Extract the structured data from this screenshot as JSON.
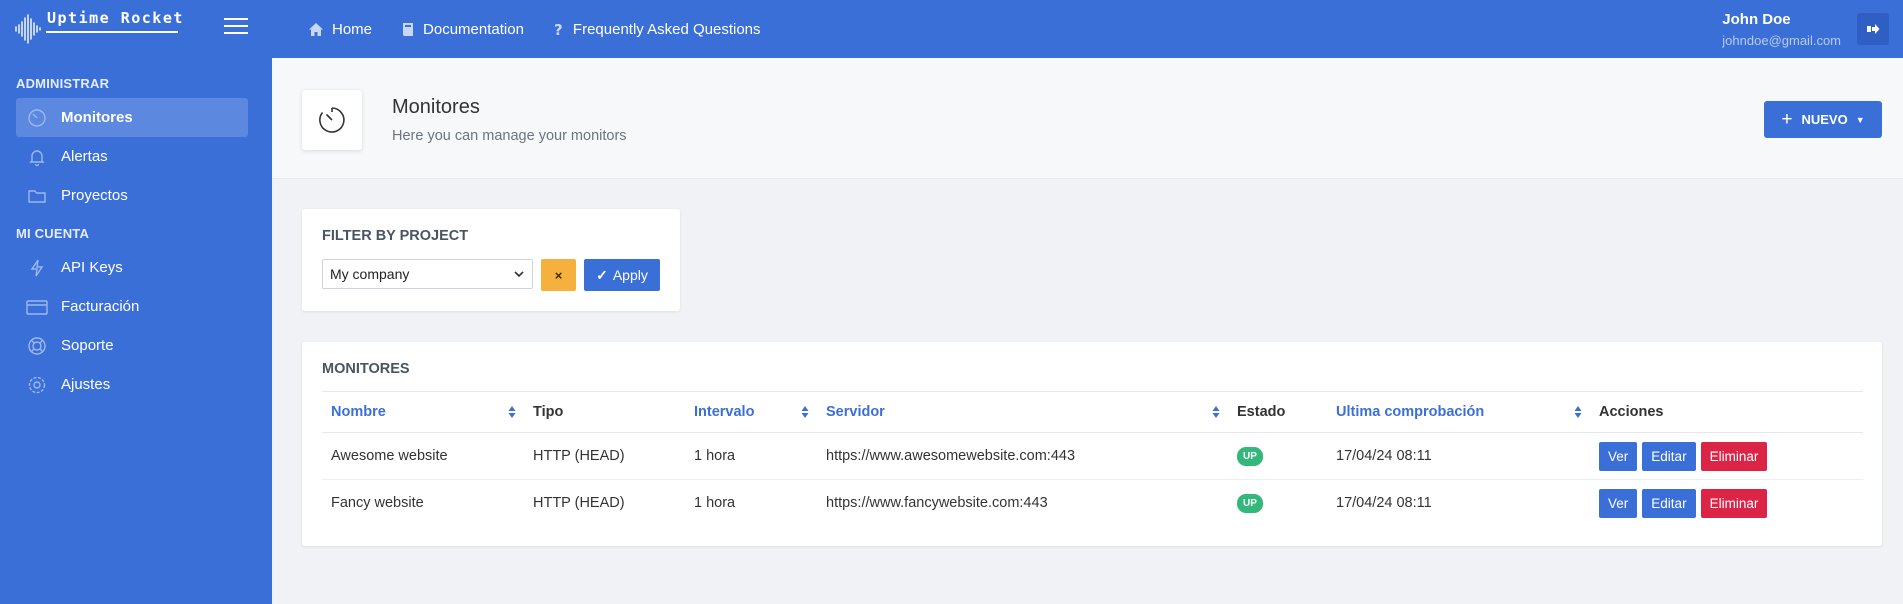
{
  "brand": {
    "title": "Uptime Rocket"
  },
  "sidebar": {
    "sections": [
      {
        "title": "ADMINISTRAR",
        "items": [
          {
            "label": "Monitores",
            "icon": "clock-icon",
            "active": true
          },
          {
            "label": "Alertas",
            "icon": "bell-icon"
          },
          {
            "label": "Proyectos",
            "icon": "folder-icon"
          }
        ]
      },
      {
        "title": "MI CUENTA",
        "items": [
          {
            "label": "API Keys",
            "icon": "bolt-icon"
          },
          {
            "label": "Facturación",
            "icon": "credit-card-icon"
          },
          {
            "label": "Soporte",
            "icon": "lifebuoy-icon"
          },
          {
            "label": "Ajustes",
            "icon": "gear-icon"
          }
        ]
      }
    ]
  },
  "topnav": {
    "items": [
      {
        "label": "Home",
        "icon": "home-icon"
      },
      {
        "label": "Documentation",
        "icon": "book-icon"
      },
      {
        "label": "Frequently Asked Questions",
        "icon": "question-icon"
      }
    ]
  },
  "user": {
    "name": "John Doe",
    "email": "johndoe@gmail.com"
  },
  "header": {
    "title": "Monitores",
    "subtitle": "Here you can manage your monitors",
    "new_button": "NUEVO"
  },
  "filter": {
    "title": "FILTER BY PROJECT",
    "selected": "My company",
    "clear_label": "×",
    "apply_label": "Apply"
  },
  "monitors": {
    "title": "MONITORES",
    "columns": {
      "name": "Nombre",
      "type": "Tipo",
      "interval": "Intervalo",
      "server": "Servidor",
      "status": "Estado",
      "last_check": "Ultima comprobación",
      "actions": "Acciones"
    },
    "rows": [
      {
        "name": "Awesome website",
        "type": "HTTP (HEAD)",
        "interval": "1 hora",
        "server": "https://www.awesomewebsite.com:443",
        "status": "UP",
        "last_check": "17/04/24 08:11"
      },
      {
        "name": "Fancy website",
        "type": "HTTP (HEAD)",
        "interval": "1 hora",
        "server": "https://www.fancywebsite.com:443",
        "status": "UP",
        "last_check": "17/04/24 08:11"
      }
    ],
    "actions": {
      "view": "Ver",
      "edit": "Editar",
      "delete": "Eliminar"
    }
  },
  "colors": {
    "primary": "#3b6fd8",
    "warning": "#f5b03e",
    "danger": "#dc2447",
    "success": "#33b77a"
  }
}
